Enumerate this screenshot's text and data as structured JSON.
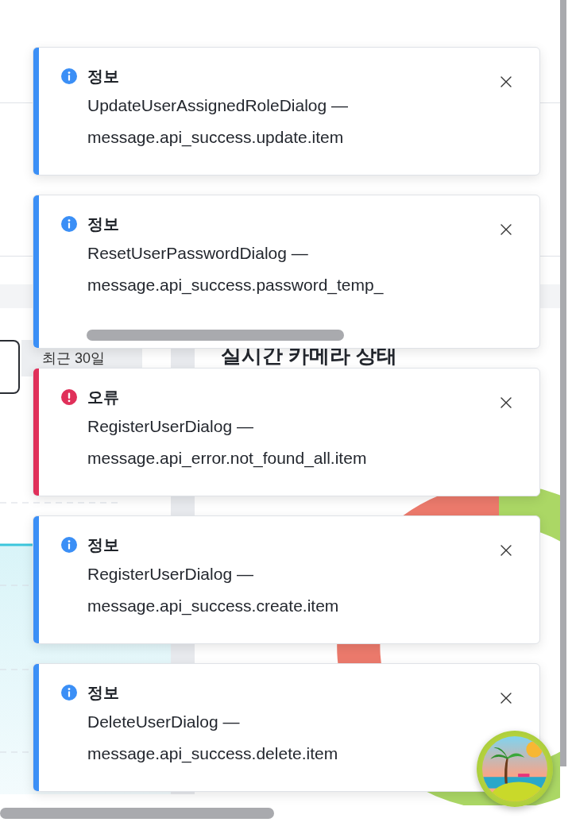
{
  "dashboard": {
    "period_tab": "최근 30일",
    "camera_panel": {
      "title": "실시간 카메라 상태"
    }
  },
  "toasts": [
    {
      "kind": "info",
      "title": "정보",
      "source": "UpdateUserAssignedRoleDialog —",
      "message": "message.api_success.update.item"
    },
    {
      "kind": "info",
      "title": "정보",
      "source": "ResetUserPasswordDialog —",
      "message": "message.api_success.password_temp_"
    },
    {
      "kind": "error",
      "title": "오류",
      "source": "RegisterUserDialog —",
      "message": "message.api_error.not_found_all.item"
    },
    {
      "kind": "info",
      "title": "정보",
      "source": "RegisterUserDialog —",
      "message": "message.api_success.create.item"
    },
    {
      "kind": "info",
      "title": "정보",
      "source": "DeleteUserDialog —",
      "message": "message.api_success.delete.item"
    }
  ]
}
